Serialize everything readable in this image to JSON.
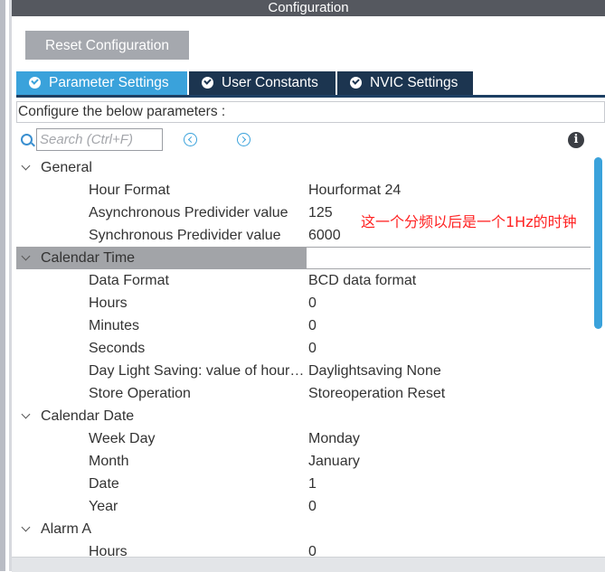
{
  "window": {
    "title": "Configuration"
  },
  "toolbar": {
    "reset_label": "Reset Configuration"
  },
  "tabs": [
    {
      "label": "Parameter Settings",
      "active": true
    },
    {
      "label": "User Constants",
      "active": false
    },
    {
      "label": "NVIC Settings",
      "active": false
    }
  ],
  "configure_text": "Configure the below parameters :",
  "search": {
    "placeholder": "Search (Ctrl+F)"
  },
  "tree": {
    "general": {
      "label": "General",
      "items": [
        {
          "name": "Hour Format",
          "value": "Hourformat 24"
        },
        {
          "name": "Asynchronous Predivider value",
          "value": "125"
        },
        {
          "name": "Synchronous Predivider value",
          "value": "6000"
        }
      ]
    },
    "calendar_time": {
      "label": "Calendar Time",
      "items": [
        {
          "name": "Data Format",
          "value": "BCD data format"
        },
        {
          "name": "Hours",
          "value": "0"
        },
        {
          "name": "Minutes",
          "value": "0"
        },
        {
          "name": "Seconds",
          "value": "0"
        },
        {
          "name": "Day Light Saving: value of hour…",
          "value": "Daylightsaving None"
        },
        {
          "name": "Store Operation",
          "value": "Storeoperation Reset"
        }
      ]
    },
    "calendar_date": {
      "label": "Calendar Date",
      "items": [
        {
          "name": "Week Day",
          "value": "Monday"
        },
        {
          "name": "Month",
          "value": "January"
        },
        {
          "name": "Date",
          "value": "1"
        },
        {
          "name": "Year",
          "value": "0"
        }
      ]
    },
    "alarm_a": {
      "label": "Alarm A",
      "items": [
        {
          "name": "Hours",
          "value": "0"
        }
      ]
    }
  },
  "annotation": "这一个分频以后是一个1Hz的时钟",
  "colors": {
    "accent": "#3aa2db",
    "tab_dark": "#1c3550",
    "annotation": "#ff2222"
  }
}
